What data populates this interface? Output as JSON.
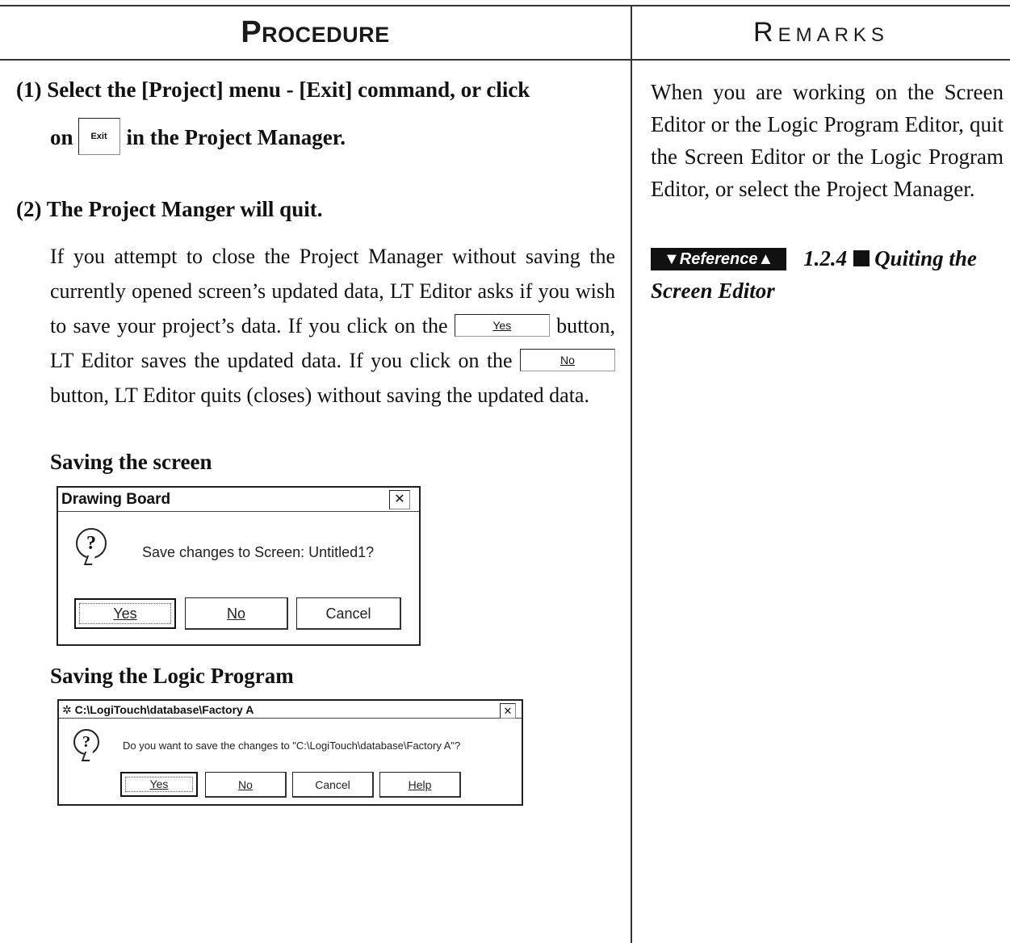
{
  "header": {
    "procedure": "Procedure",
    "remarks": "Remarks"
  },
  "steps": {
    "step1_line1": "(1) Select the [Project] menu - [Exit] command, or click",
    "step1_on": "on",
    "step1_exit_icon": "Exit",
    "step1_tail": "in the Project Manager.",
    "step2": "(2) The Project Manger will quit."
  },
  "paragraph": {
    "part1": "If you attempt to close the Project Manager without saving the currently opened screen’s updated data, LT Editor asks if you wish to save your project’s data. If you click on the",
    "yes_button": "Yes",
    "part2": "button, LT Editor saves the updated data. If you click on the",
    "no_button": "No",
    "part3": "button, LT Editor quits (closes) without saving the updated data."
  },
  "section_screen": {
    "title": "Saving the screen",
    "dialog": {
      "title": "Drawing Board",
      "message": "Save changes to Screen: Untitled1?",
      "buttons": [
        "Yes",
        "No",
        "Cancel"
      ]
    }
  },
  "section_logic": {
    "title": "Saving the Logic Program",
    "dialog": {
      "title": "C:\\LogiTouch\\database\\Factory A",
      "message": "Do you want to save the changes to \"C:\\LogiTouch\\database\\Factory A\"?",
      "buttons": [
        "Yes",
        "No",
        "Cancel",
        "Help"
      ]
    }
  },
  "remarks": {
    "text": "When you are working on the Screen Editor or the Logic Program Editor, quit the Screen Editor or the Logic Program Editor, or select the Project Manager.",
    "reference_badge": "Reference",
    "reference_number": "1.2.4",
    "reference_text": "Quiting the Screen Editor"
  },
  "icons": {
    "close": "close-icon",
    "question": "question-icon",
    "app": "app-icon"
  }
}
